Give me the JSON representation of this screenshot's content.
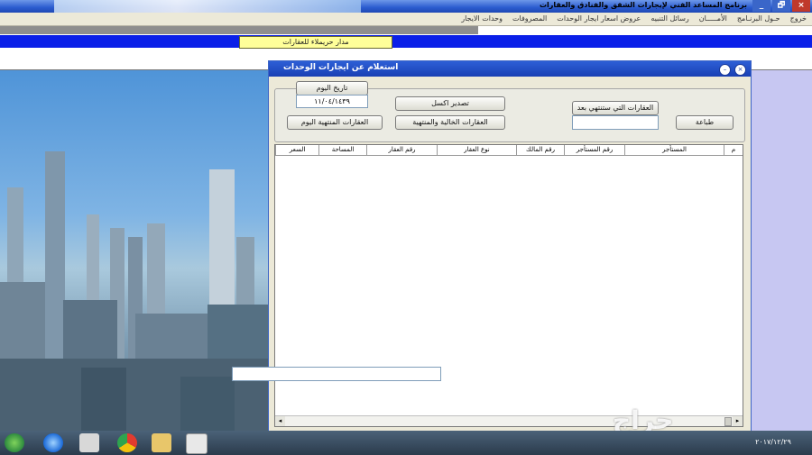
{
  "window": {
    "title": "برنامج المساعد الفني لإيجارات الشقق والفنادق والعقارات",
    "controls": [
      "×",
      "🗗",
      "_"
    ]
  },
  "menu": {
    "items": [
      "وحدات الايجار",
      "المصروفات",
      "عروض اسعار ايجار الوحدات",
      "رسائل التنبيه",
      "الأمـــــان",
      "حـول البرنـامج",
      "خروج"
    ]
  },
  "banner": {
    "company": "مدار حريملاء للعقارات"
  },
  "dialog": {
    "title": "استعلام عن ايجارات الوحدات",
    "today_label": "تاريخ اليوم",
    "today_value": "١١/٠٤/١٤٣٩",
    "btn_export": "تصدير اكسل",
    "btn_vacant_expired": "العقارات الخالية والمنتهية",
    "btn_expired_today": "العقارات المنتهية اليوم",
    "btn_expiring_after": "العقارات التي ستنتهي بعد",
    "expiring_after_value": "",
    "btn_print": "طباعة",
    "columns": [
      "م",
      "المستأجر",
      "رقم المستأجر",
      "رقم المالك",
      "نوع العقار",
      "رقم العقار",
      "المساحة",
      "السعر"
    ]
  },
  "taskbar": {
    "clock": "٢٠١٧/١٢/٢٩"
  },
  "watermark": "حراج"
}
